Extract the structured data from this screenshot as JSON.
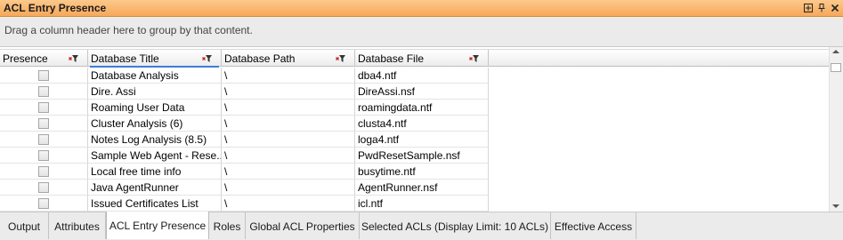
{
  "panel": {
    "title": "ACL Entry Presence",
    "group_hint": "Drag a column header here to group by that content."
  },
  "titlebar_icons": [
    "maximize-icon",
    "pin-icon",
    "close-icon"
  ],
  "columns": [
    "Presence",
    "Database Title",
    "Database Path",
    "Database File"
  ],
  "rows": [
    {
      "title": "Database Analysis",
      "path": "\\",
      "file": "dba4.ntf"
    },
    {
      "title": "Dire. Assi",
      "path": "\\",
      "file": "DireAssi.nsf"
    },
    {
      "title": "Roaming User Data",
      "path": "\\",
      "file": "roamingdata.ntf"
    },
    {
      "title": "Cluster Analysis (6)",
      "path": "\\",
      "file": "clusta4.ntf"
    },
    {
      "title": "Notes Log Analysis (8.5)",
      "path": "\\",
      "file": "loga4.ntf"
    },
    {
      "title": "Sample Web Agent - Rese...",
      "path": "\\",
      "file": "PwdResetSample.nsf"
    },
    {
      "title": "Local free time info",
      "path": "\\",
      "file": "busytime.ntf"
    },
    {
      "title": "Java AgentRunner",
      "path": "\\",
      "file": "AgentRunner.nsf"
    },
    {
      "title": "Issued Certificates List",
      "path": "\\",
      "file": "icl.ntf"
    }
  ],
  "tabs": [
    {
      "label": "Output",
      "active": false
    },
    {
      "label": "Attributes",
      "active": false
    },
    {
      "label": "ACL Entry Presence",
      "active": true
    },
    {
      "label": "Roles",
      "active": false
    },
    {
      "label": "Global ACL Properties",
      "active": false
    },
    {
      "label": "Selected ACLs (Display Limit: 10 ACLs)",
      "active": false
    },
    {
      "label": "Effective Access",
      "active": false
    }
  ],
  "colors": {
    "title_bar": "#f6a85a",
    "sort_indicator": "#3c7fd6"
  }
}
